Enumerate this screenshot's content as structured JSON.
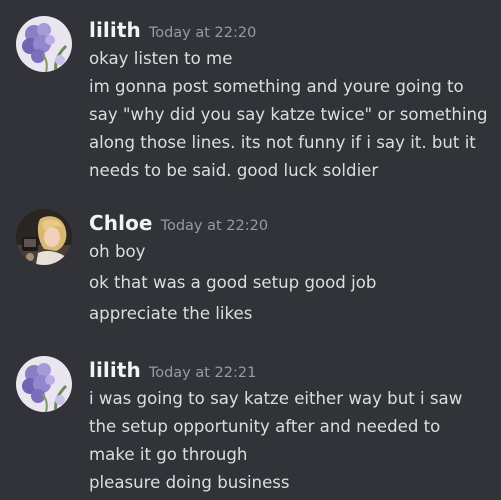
{
  "messages": [
    {
      "author": "lilith",
      "timestamp": "Today at 22:20",
      "avatar": "purple-flowers-avatar",
      "lines": [
        "okay listen to me",
        "im gonna post something and youre going to",
        "say \"why did you say katze twice\" or something",
        "along those lines. its not funny if i say it. but it",
        "needs to be said. good luck soldier"
      ]
    },
    {
      "author": "Chloe",
      "timestamp": "Today at 22:20",
      "avatar": "blonde-character-avatar",
      "lines": [
        "oh boy",
        "ok that was a good setup good job",
        "appreciate the likes"
      ]
    },
    {
      "author": "lilith",
      "timestamp": "Today at 22:21",
      "avatar": "purple-flowers-avatar",
      "lines": [
        "i was going to say katze either way but i saw",
        "the setup opportunity after and needed to",
        "make it go through",
        "pleasure doing business"
      ]
    }
  ],
  "colors": {
    "background": "#313338",
    "username": "#f2f3f5",
    "timestamp": "#949ba4",
    "text": "#dbdee1"
  }
}
